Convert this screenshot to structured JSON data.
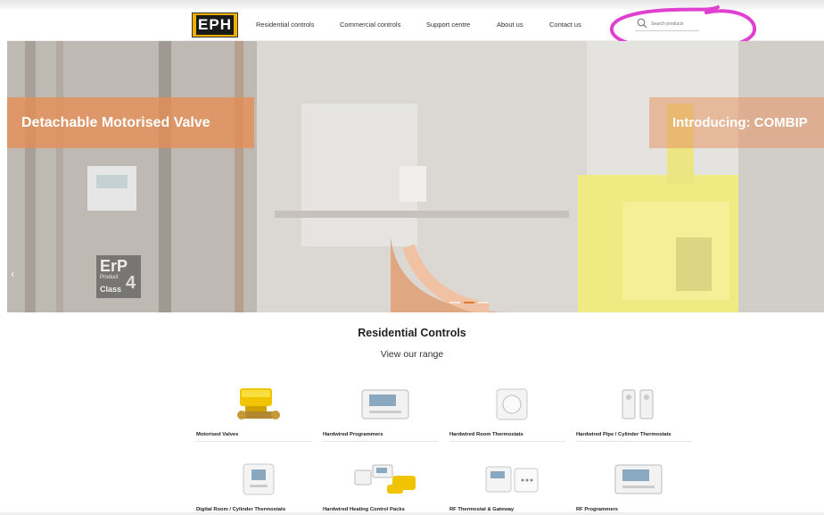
{
  "header": {
    "logo_text": "EPH",
    "nav": [
      "Residential controls",
      "Commercial controls",
      "Support centre",
      "About us",
      "Contact us"
    ],
    "search_placeholder": "Search products"
  },
  "hero": {
    "slide_label": "Detachable Motorised Valve",
    "next_slide_label": "Introducing: COMBIP",
    "badge": {
      "line1": "ErP",
      "line2": "Product",
      "line3": "Class",
      "number": "4"
    },
    "prev_arrow": "‹",
    "dots": 3,
    "active_dot": 1
  },
  "section": {
    "title": "Residential Controls",
    "subtitle": "View our range"
  },
  "products": [
    {
      "name": "Motorised Valves",
      "icon": "motorised-valve-icon"
    },
    {
      "name": "Hardwired Programmers",
      "icon": "programmer-icon"
    },
    {
      "name": "Hardwired Room Thermostats",
      "icon": "room-thermostat-icon"
    },
    {
      "name": "Hardwired Pipe / Cylinder Thermostats",
      "icon": "pipe-thermostat-icon"
    },
    {
      "name": "Digital Room / Cylinder Thermostats",
      "icon": "digital-thermostat-icon"
    },
    {
      "name": "Hardwired Heating Control Packs",
      "icon": "control-pack-icon"
    },
    {
      "name": "RF Thermostat & Gateway",
      "icon": "rf-thermostat-icon"
    },
    {
      "name": "RF Programmers",
      "icon": "rf-programmer-icon"
    }
  ],
  "colors": {
    "accent": "#e07a30",
    "annotation": "#e040d0",
    "logo_yellow": "#f0b000"
  }
}
